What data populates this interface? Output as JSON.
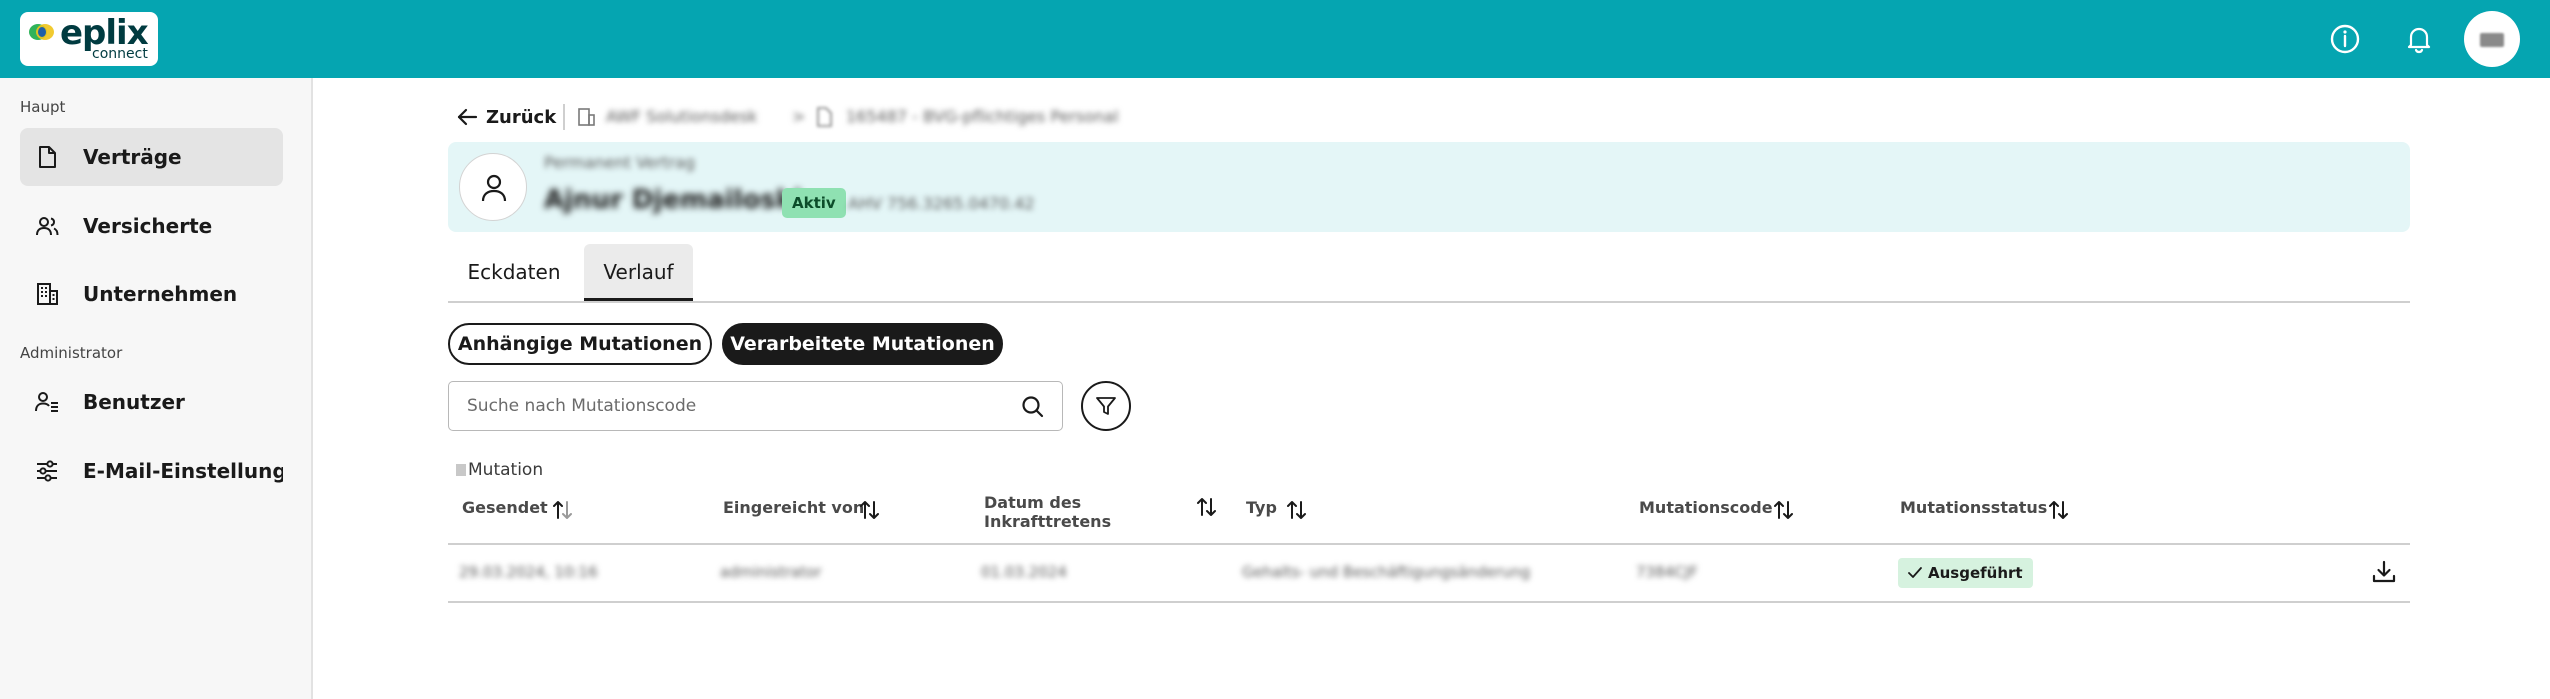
{
  "header": {
    "logo_text": "eplix",
    "logo_sub": "connect",
    "brand_color": "#05a5b1",
    "icons": [
      "info-icon",
      "bell-icon"
    ]
  },
  "sidebar": {
    "section_main": "Haupt",
    "section_admin": "Administrator",
    "items": [
      {
        "label": "Verträge",
        "icon": "document-icon",
        "active": true
      },
      {
        "label": "Versicherte",
        "icon": "users-icon",
        "active": false
      },
      {
        "label": "Unternehmen",
        "icon": "building-icon",
        "active": false
      },
      {
        "label": "Benutzer",
        "icon": "user-list-icon",
        "active": false
      },
      {
        "label": "E-Mail-Einstellungen",
        "icon": "sliders-icon",
        "active": false
      }
    ]
  },
  "breadcrumb": {
    "back_label": "Zurück",
    "company": "AWF Solutionsdesk",
    "contract": "165487 - BVG-pflichtiges Personal"
  },
  "banner": {
    "kicker": "Permanent Vertrag",
    "name": "Ajnur Djemailoski",
    "status": "Aktiv",
    "ahv": "AHV 756.3265.0470.42",
    "accent_color": "#e4f6f7"
  },
  "tabs": [
    {
      "label": "Eckdaten",
      "active": false
    },
    {
      "label": "Verlauf",
      "active": true
    }
  ],
  "filters": {
    "pending_label": "Anhängige Mutationen",
    "processed_label": "Verarbeitete Mutationen"
  },
  "search": {
    "placeholder": "Suche nach Mutationscode"
  },
  "table": {
    "caption": "Mutation",
    "columns": [
      "Gesendet",
      "Eingereicht von",
      "Datum des Inkrafttretens",
      "Typ",
      "Mutationscode",
      "Mutationsstatus"
    ],
    "rows": [
      {
        "sent": "29.03.2024, 10:16",
        "submitted_by": "administrator",
        "effective_date": "01.03.2024",
        "type": "Gehalts- und Beschäftigungsänderung",
        "code": "7384CJF",
        "status": "Ausgeführt",
        "status_color": "#d6f2df"
      }
    ]
  }
}
